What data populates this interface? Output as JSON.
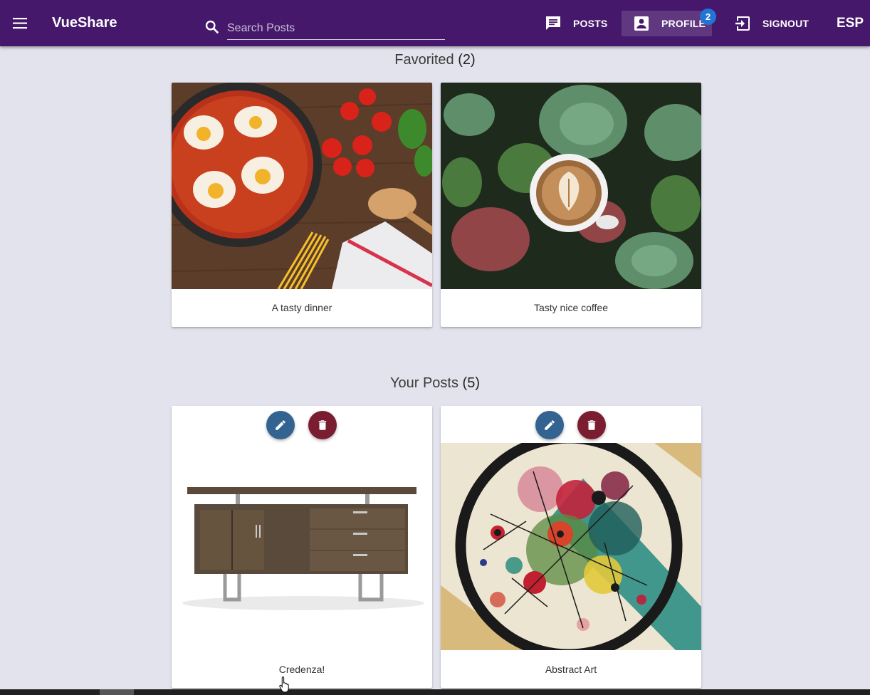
{
  "app": {
    "title": "VueShare"
  },
  "search": {
    "placeholder": "Search Posts"
  },
  "nav": {
    "posts_label": "POSTS",
    "profile_label": "PROFILE",
    "profile_badge": "2",
    "signout_label": "SIGNOUT",
    "language": "ESP"
  },
  "favorited": {
    "title": "Favorited",
    "count": "(2)",
    "cards": [
      {
        "caption": "A tasty dinner",
        "image": "shakshuka-pan-photo"
      },
      {
        "caption": "Tasty nice coffee",
        "image": "latte-succulents-photo"
      }
    ]
  },
  "your_posts": {
    "title": "Your Posts",
    "count": "(5)",
    "cards": [
      {
        "caption": "Credenza!",
        "image": "wooden-credenza-photo"
      },
      {
        "caption": "Abstract Art",
        "image": "circles-painting"
      }
    ]
  },
  "colors": {
    "toolbar": "#45186b",
    "background": "#e3e3ee",
    "edit_button": "#336491",
    "delete_button": "#7a1d30",
    "badge": "#2275d7"
  }
}
